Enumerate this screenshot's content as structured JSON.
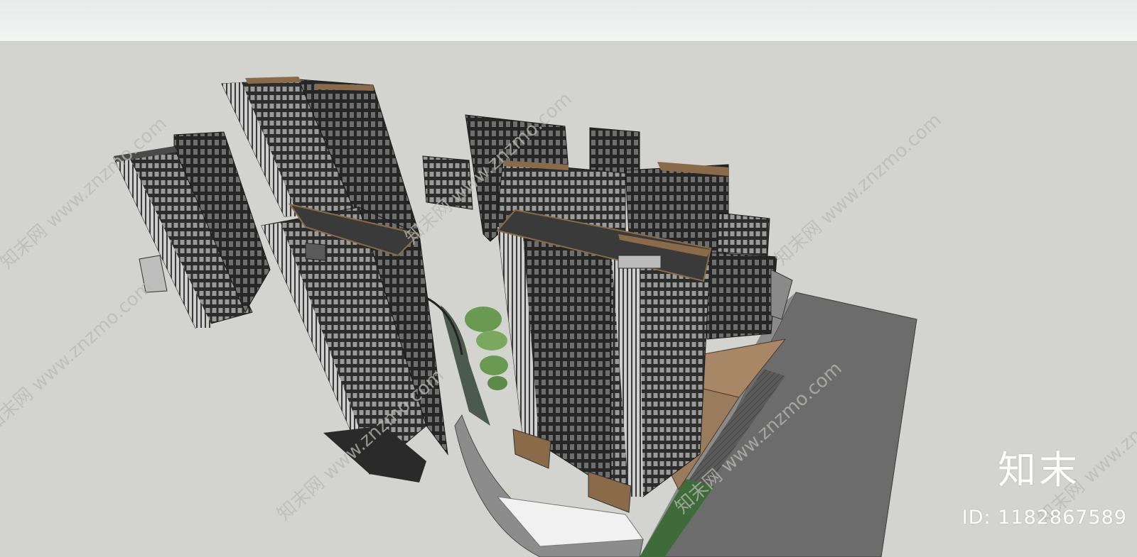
{
  "viewport": {
    "sky_color": "#edeeee",
    "ground_color": "#d3d3cf"
  },
  "model": {
    "building_color": "#2e2e2e",
    "facade_light_color": "#c4c4c4",
    "accent_color": "#8a6a48",
    "road_color": "#6c6c6c",
    "lawn_color": "#3f6b3a"
  },
  "watermark": {
    "repeat_text": "知末网 www.znzmo.com",
    "logo_text": "知末",
    "id_text": "ID: 1182867589"
  }
}
